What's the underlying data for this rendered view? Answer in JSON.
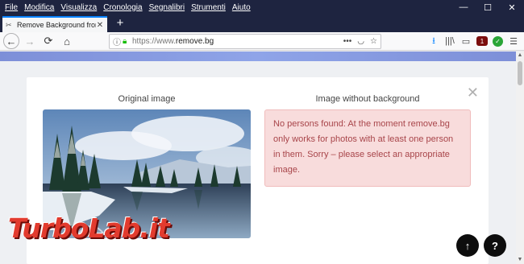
{
  "menu": [
    "File",
    "Modifica",
    "Visualizza",
    "Cronologia",
    "Segnalibri",
    "Strumenti",
    "Aiuto"
  ],
  "window_controls": {
    "minimize": "—",
    "maximize": "☐",
    "close": "✕"
  },
  "tab": {
    "title": "Remove Background from Ima",
    "favicon": "scissors-icon",
    "close": "✕"
  },
  "newtab": "+",
  "nav": {
    "back": "←",
    "forward": "→",
    "reload": "⟳",
    "home": "⌂"
  },
  "urlbar": {
    "prefix": "https://www.",
    "domain": "remove.bg",
    "more": "•••"
  },
  "card": {
    "close": "✕",
    "left_title": "Original image",
    "right_title": "Image without background",
    "error": "No persons found: At the moment remove.bg only works for photos with at least one person in them. Sorry – please select an appropriate image."
  },
  "fab": {
    "up": "↑",
    "help": "?"
  },
  "watermark": "TurboLab.it",
  "colors": {
    "accent": "#0a84ff",
    "error_bg": "#f8dcdc",
    "error_text": "#a8454a",
    "titlebar": "#1e2440"
  }
}
